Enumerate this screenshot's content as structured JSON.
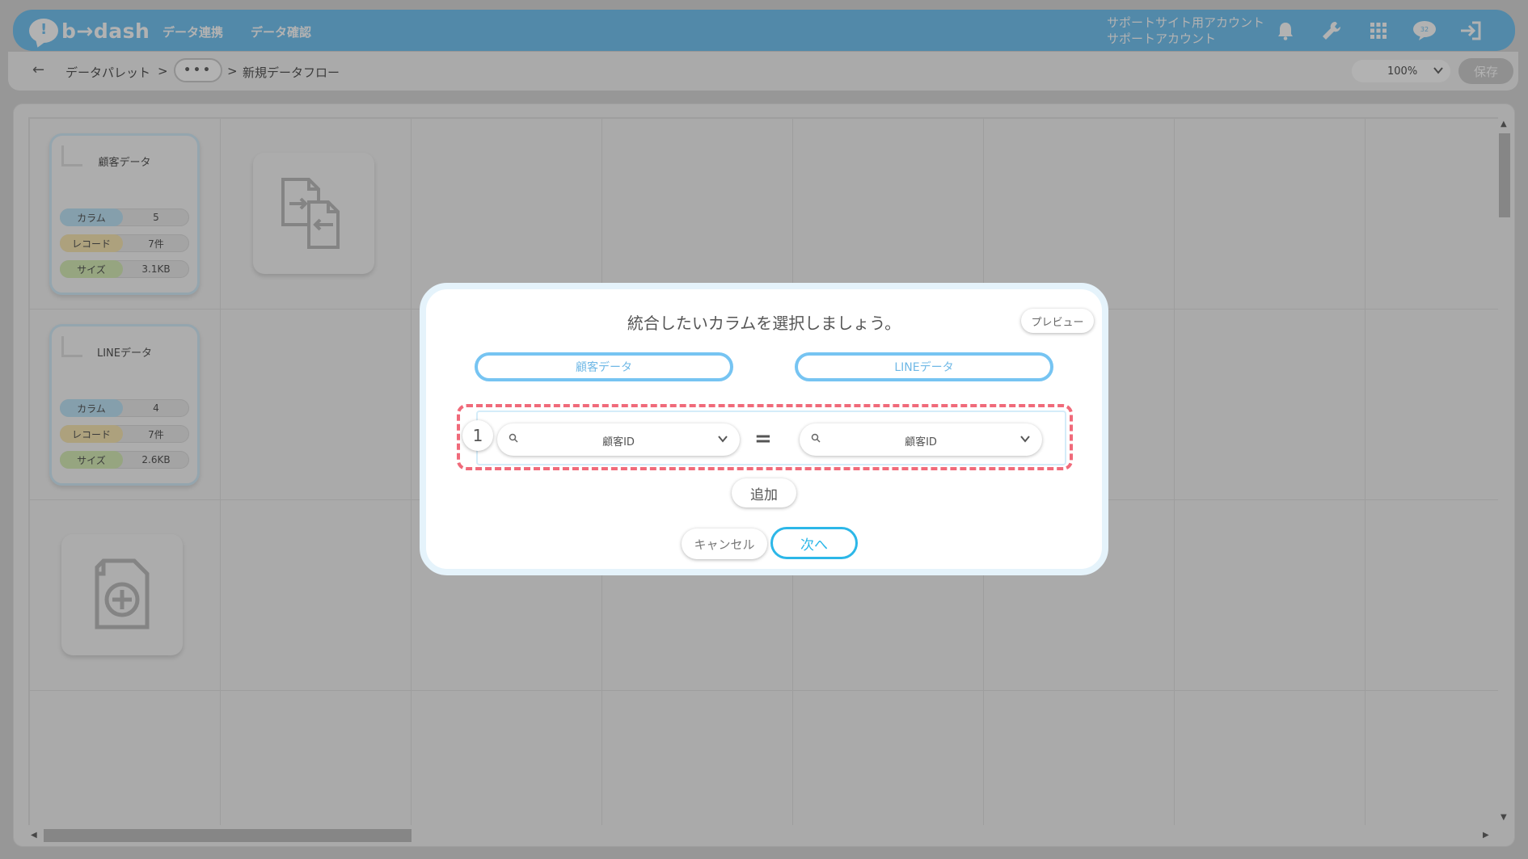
{
  "header": {
    "logo_text": "b→dash",
    "nav": [
      "データ連携",
      "データ確認"
    ],
    "account_line1": "サポートサイト用アカウント",
    "account_line2": "サポートアカウント",
    "icons": [
      "bell-icon",
      "wrench-icon",
      "apps-grid-icon",
      "chat-icon",
      "logout-icon"
    ],
    "accent_color": "#76c4f2"
  },
  "breadcrumb": {
    "back_icon": "←",
    "root": "データパレット",
    "sep": ">",
    "more": "•••",
    "current": "新規データフロー",
    "zoom": "100%",
    "save_label": "保存"
  },
  "cards": [
    {
      "name": "顧客データ",
      "stats": [
        {
          "label": "カラム",
          "value": "5",
          "color": "#bfe4f7"
        },
        {
          "label": "レコード",
          "value": "7件",
          "color": "#f8e7b4"
        },
        {
          "label": "サイズ",
          "value": "3.1KB",
          "color": "#d7edb8"
        }
      ]
    },
    {
      "name": "LINEデータ",
      "stats": [
        {
          "label": "カラム",
          "value": "4",
          "color": "#bfe4f7"
        },
        {
          "label": "レコード",
          "value": "7件",
          "color": "#f8e7b4"
        },
        {
          "label": "サイズ",
          "value": "2.6KB",
          "color": "#d7edb8"
        }
      ]
    }
  ],
  "modal": {
    "title": "統合したいカラムを選択しましょう。",
    "preview_label": "プレビュー",
    "left_source": "顧客データ",
    "right_source": "LINEデータ",
    "row_number": "1",
    "left_column": "顧客ID",
    "right_column": "顧客ID",
    "equals": "=",
    "add_label": "追加",
    "cancel_label": "キャンセル",
    "next_label": "次へ"
  }
}
